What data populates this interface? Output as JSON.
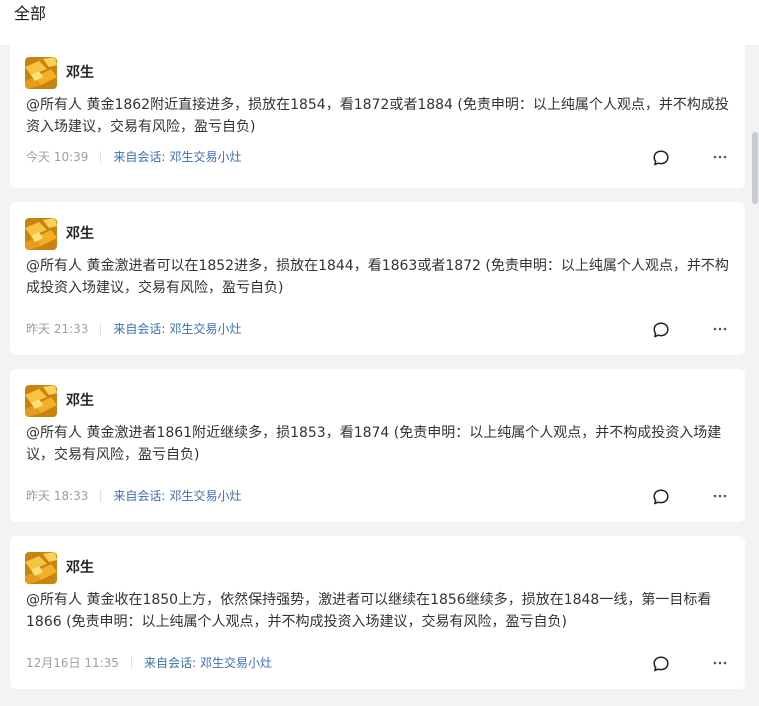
{
  "header": {
    "title": "全部"
  },
  "posts": [
    {
      "author": "邓生",
      "content": "@所有人 黄金1862附近直接进多，损放在1854，看1872或者1884 (免责申明：以上纯属个人观点，并不构成投资入场建议，交易有风险，盈亏自负)",
      "time": "今天 10:39",
      "source_label": "来自会话:",
      "source_name": "邓生交易小灶"
    },
    {
      "author": "邓生",
      "content": "@所有人 黄金激进者可以在1852进多，损放在1844，看1863或者1872 (免责申明：以上纯属个人观点，并不构成投资入场建议，交易有风险，盈亏自负)",
      "time": "昨天 21:33",
      "source_label": "来自会话:",
      "source_name": "邓生交易小灶"
    },
    {
      "author": "邓生",
      "content": "@所有人 黄金激进者1861附近继续多，损1853，看1874 (免责申明：以上纯属个人观点，并不构成投资入场建议，交易有风险，盈亏自负)",
      "time": "昨天 18:33",
      "source_label": "来自会话:",
      "source_name": "邓生交易小灶"
    },
    {
      "author": "邓生",
      "content": "@所有人 黄金收在1850上方，依然保持强势，激进者可以继续在1856继续多，损放在1848一线，第一目标看1866 (免责申明：以上纯属个人观点，并不构成投资入场建议，交易有风险，盈亏自负)",
      "time": "12月16日 11:35",
      "source_label": "来自会话:",
      "source_name": "邓生交易小灶"
    }
  ],
  "icons": {
    "comment": "comment-icon",
    "more": "more-icon",
    "avatar": "gold-bars-avatar"
  },
  "colors": {
    "background": "#f2f3f5",
    "card": "#ffffff",
    "link": "#3b6fb6",
    "muted": "#9aa0a6"
  }
}
